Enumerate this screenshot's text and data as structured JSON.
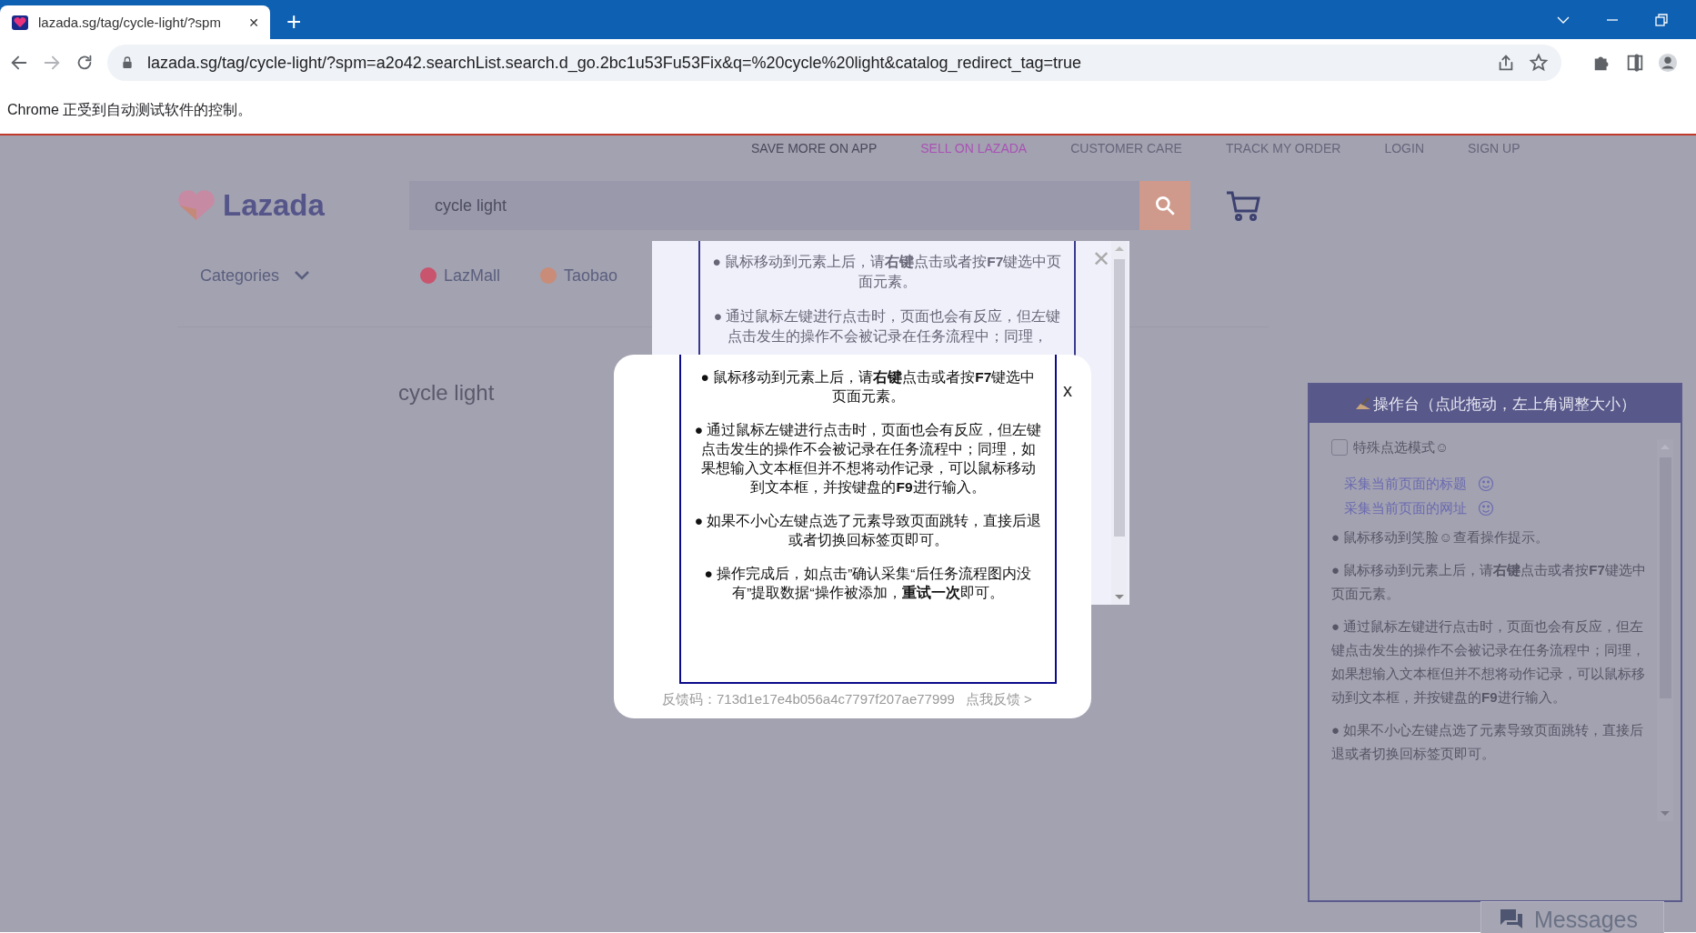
{
  "browser": {
    "tab_title": "lazada.sg/tag/cycle-light/?spm",
    "tab_close": "✕",
    "new_tab": "+",
    "url": "lazada.sg/tag/cycle-light/?spm=a2o42.searchList.search.d_go.2bc1u53Fu53Fix&q=%20cycle%20light&catalog_redirect_tag=true",
    "automation_notice": "Chrome 正受到自动测试软件的控制。"
  },
  "page": {
    "top_links": [
      {
        "label": "SAVE MORE ON APP",
        "color": "#4a4a5c"
      },
      {
        "label": "SELL ON LAZADA",
        "color": "#a952b4"
      },
      {
        "label": "CUSTOMER CARE",
        "color": "#66657a"
      },
      {
        "label": "TRACK MY ORDER",
        "color": "#66657a"
      },
      {
        "label": "LOGIN",
        "color": "#66657a"
      },
      {
        "label": "SIGN UP",
        "color": "#66657a"
      }
    ],
    "logo": "Lazada",
    "search": {
      "value": "cycle light"
    },
    "categories": "Categories",
    "channels": [
      {
        "label": "LazMall",
        "color": "#c8546e"
      },
      {
        "label": "Taobao",
        "color": "#c98c78"
      }
    ],
    "heading": "cycle light"
  },
  "back_popup": {
    "close": "✕",
    "tips": [
      "● 鼠标移动到元素上后，请**右键**点击或者按**F7**键选中页面元素。",
      "● 通过鼠标左键进行点击时，页面也会有反应，但左键点击发生的操作不会被记录在任务流程中；同理，"
    ]
  },
  "front_popup": {
    "close": "x",
    "tips": [
      "● 鼠标移动到元素上后，请**右键**点击或者按**F7**键选中页面元素。",
      "● 通过鼠标左键进行点击时，页面也会有反应，但左键点击发生的操作不会被记录在任务流程中；同理，如果想输入文本框但并不想将动作记录，可以鼠标移动到文本框，并按键盘的**F9**进行输入。",
      "● 如果不小心左键点选了元素导致页面跳转，直接后退或者切换回标签页即可。",
      "● 操作完成后，如点击”确认采集“后任务流程图内没有”提取数据“操作被添加，**重试一次**即可。"
    ],
    "feedback_code": "反馈码：713d1e17e4b056a4c7797f207ae77999",
    "feedback_link": "点我反馈 >"
  },
  "panel": {
    "title": "操作台（点此拖动，左上角调整大小）",
    "special_mode": {
      "label": "特殊点选模式☺",
      "checked": false
    },
    "actions": [
      "采集当前页面的标题",
      "采集当前页面的网址"
    ],
    "tips": [
      "● 鼠标移动到笑脸☺查看操作提示。",
      "● 鼠标移动到元素上后，请**右键**点击或者按**F7**键选中页面元素。",
      "● 通过鼠标左键进行点击时，页面也会有反应，但左键点击发生的操作不会被记录在任务流程中；同理，如果想输入文本框但并不想将动作记录，可以鼠标移动到文本框，并按键盘的**F9**进行输入。",
      "● 如果不小心左键点选了元素导致页面跳转，直接后退或者切换回标签页即可。"
    ]
  },
  "messages": "Messages"
}
